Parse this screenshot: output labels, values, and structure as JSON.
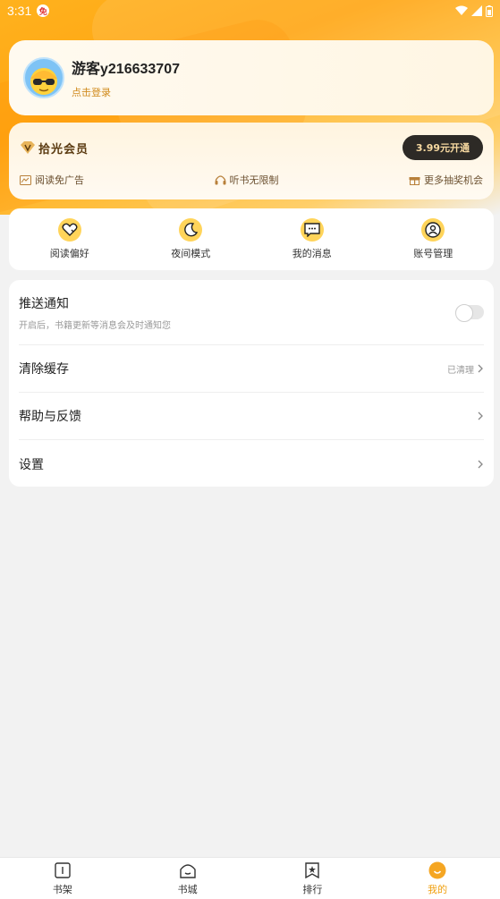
{
  "status_bar": {
    "time": "3:31",
    "app_badge": "免"
  },
  "profile": {
    "username": "游客y216633707",
    "login_label": "点击登录"
  },
  "vip": {
    "title": "拾光会员",
    "button_label": "3.99元开通",
    "perks": [
      {
        "icon": "ad-free-icon",
        "label": "阅读免广告"
      },
      {
        "icon": "headphones-icon",
        "label": "听书无限制"
      },
      {
        "icon": "gift-icon",
        "label": "更多抽奖机会"
      }
    ]
  },
  "quick_actions": [
    {
      "icon": "heart-icon",
      "label": "阅读偏好"
    },
    {
      "icon": "moon-icon",
      "label": "夜间模式"
    },
    {
      "icon": "message-icon",
      "label": "我的消息"
    },
    {
      "icon": "user-icon",
      "label": "账号管理"
    }
  ],
  "settings": {
    "push": {
      "title": "推送通知",
      "subtitle": "开启后，书籍更新等消息会及时通知您",
      "enabled": false
    },
    "cache": {
      "title": "清除缓存",
      "value": "已清理"
    },
    "help": {
      "title": "帮助与反馈"
    },
    "settings": {
      "title": "设置"
    }
  },
  "tabs": [
    {
      "label": "书架",
      "icon": "bookshelf-icon",
      "active": false
    },
    {
      "label": "书城",
      "icon": "store-icon",
      "active": false
    },
    {
      "label": "排行",
      "icon": "ranking-icon",
      "active": false
    },
    {
      "label": "我的",
      "icon": "me-icon",
      "active": true
    }
  ],
  "colors": {
    "accent": "#f0a010",
    "vip_button_bg": "#2d2a26",
    "vip_button_text": "#f7d9a0"
  }
}
